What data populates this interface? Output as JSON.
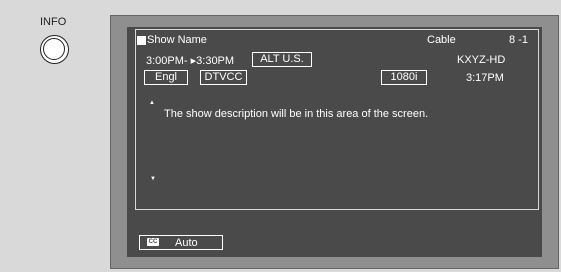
{
  "remote": {
    "info_label": "INFO"
  },
  "banner": {
    "show_name": "Show Name",
    "source": "Cable",
    "channel": "8 -1",
    "time_range": "3:00PM- ▸3:30PM",
    "rating": "ALT U.S.",
    "station": "KXYZ-HD",
    "audio": "Engl",
    "caption_service": "DTVCC",
    "resolution": "1080i",
    "clock": "3:17PM",
    "description": "The show description will be in this area of the screen.",
    "scroll_up_icon": "triangle-up",
    "scroll_down_icon": "triangle-down"
  },
  "cc": {
    "icon_text": "CC",
    "mode": "Auto"
  }
}
